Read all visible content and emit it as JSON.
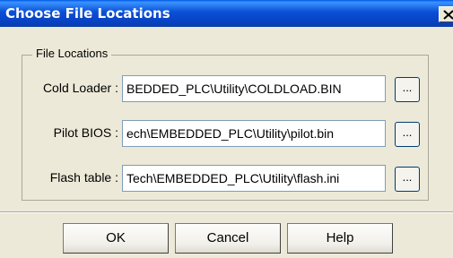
{
  "window": {
    "title": "Choose File Locations",
    "close_label": "X"
  },
  "group": {
    "legend": "File Locations"
  },
  "fields": [
    {
      "label": "Cold Loader :",
      "value": "BEDDED_PLC\\Utility\\COLDLOAD.BIN",
      "browse_label": "..."
    },
    {
      "label": "Pilot BIOS :",
      "value": "ech\\EMBEDDED_PLC\\Utility\\pilot.bin",
      "browse_label": "..."
    },
    {
      "label": "Flash table :",
      "value": "Tech\\EMBEDDED_PLC\\Utility\\flash.ini",
      "browse_label": "..."
    }
  ],
  "buttons": {
    "ok": "OK",
    "cancel": "Cancel",
    "help": "Help"
  },
  "colors": {
    "titlebar": "#0a4fd6",
    "dialog_bg": "#ece9d8",
    "input_border": "#7f9db9"
  }
}
